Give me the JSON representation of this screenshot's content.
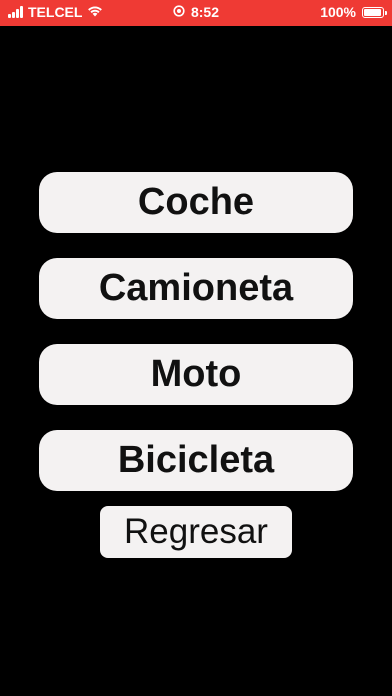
{
  "status_bar": {
    "carrier": "TELCEL",
    "time": "8:52",
    "battery": "100%",
    "battery_level": 1.0,
    "background_color": "#ef3a34",
    "icons": [
      "signal-bars-icon",
      "wifi-icon",
      "location-icon",
      "battery-icon"
    ]
  },
  "menu": {
    "items": [
      {
        "label": "Coche"
      },
      {
        "label": "Camioneta"
      },
      {
        "label": "Moto"
      },
      {
        "label": "Bicicleta"
      }
    ],
    "back_label": "Regresar"
  },
  "colors": {
    "background": "#000000",
    "button": "#f4f2f2",
    "button_text": "#111111"
  }
}
